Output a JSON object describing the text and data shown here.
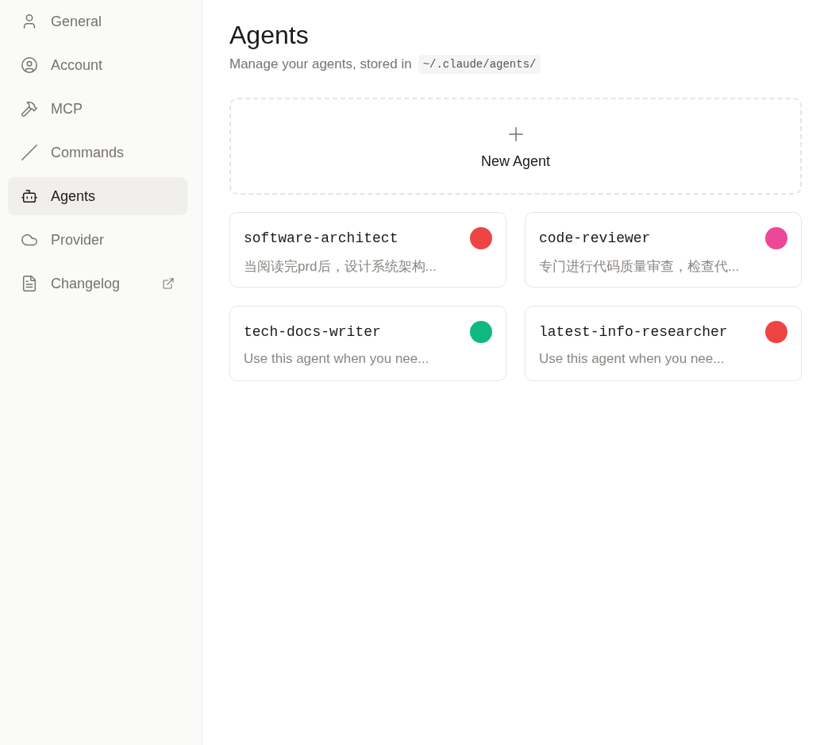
{
  "sidebar": {
    "items": [
      {
        "label": "General",
        "kind": "user",
        "selected": false,
        "external": false
      },
      {
        "label": "Account",
        "kind": "account",
        "selected": false,
        "external": false
      },
      {
        "label": "MCP",
        "kind": "hammer",
        "selected": false,
        "external": false
      },
      {
        "label": "Commands",
        "kind": "slash",
        "selected": false,
        "external": false
      },
      {
        "label": "Agents",
        "kind": "bot",
        "selected": true,
        "external": false
      },
      {
        "label": "Provider",
        "kind": "cloud",
        "selected": false,
        "external": false
      },
      {
        "label": "Changelog",
        "kind": "file",
        "selected": false,
        "external": true
      }
    ]
  },
  "header": {
    "title": "Agents",
    "subtitle": "Manage your agents, stored in",
    "path": "~/.claude/agents/"
  },
  "new_agent": {
    "label": "New Agent"
  },
  "agents": [
    {
      "name": "software-architect",
      "description": "当阅读完prd后，设计系统架构...",
      "color": "#ef4444"
    },
    {
      "name": "code-reviewer",
      "description": "专门进行代码质量审查，检查代...",
      "color": "#ec4899"
    },
    {
      "name": "tech-docs-writer",
      "description": "Use this agent when you nee...",
      "color": "#10b981"
    },
    {
      "name": "latest-info-researcher",
      "description": "Use this agent when you nee...",
      "color": "#ef4444"
    }
  ]
}
